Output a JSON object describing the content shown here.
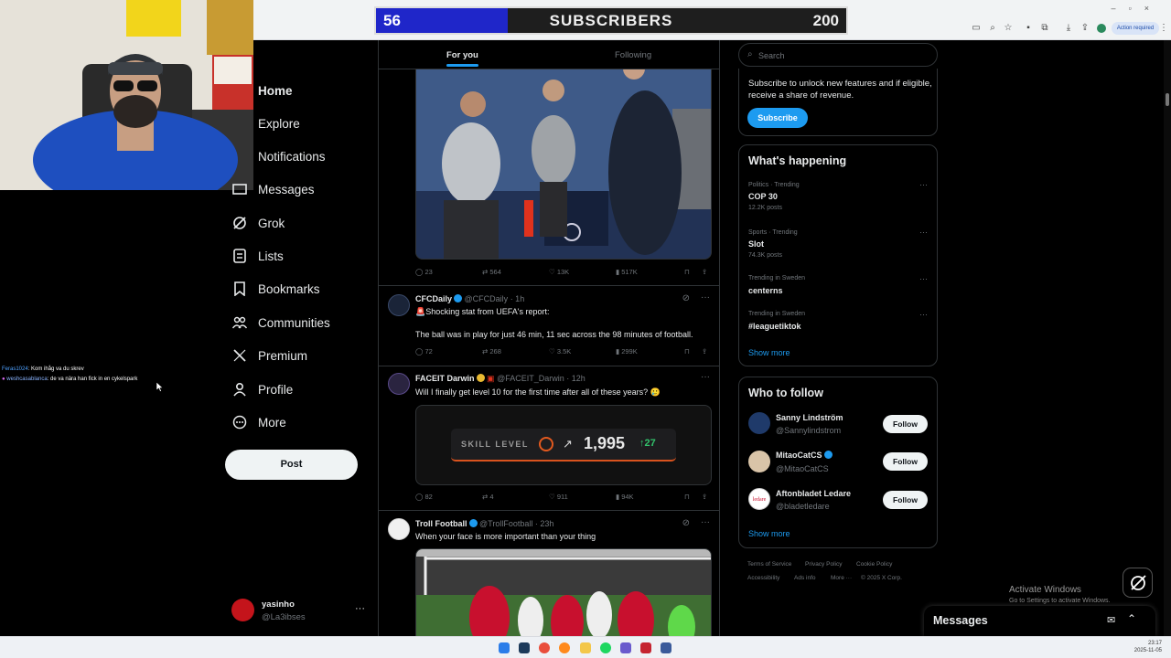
{
  "subscriber_goal": {
    "current": "56",
    "label": "SUBSCRIBERS",
    "goal": "200",
    "progress": 0.28
  },
  "browser": {
    "action_required": "Action required"
  },
  "chat": [
    {
      "user": "Feras1024",
      "message": ": Kom ihåg va du skrev"
    },
    {
      "user": "weshcasablanca",
      "message": ": de va nära han fick in en cykelspark"
    }
  ],
  "nav": {
    "items": [
      {
        "label": "Home",
        "icon": "home-icon"
      },
      {
        "label": "Explore",
        "icon": "search-icon"
      },
      {
        "label": "Notifications",
        "icon": "bell-icon"
      },
      {
        "label": "Messages",
        "icon": "mail-icon"
      },
      {
        "label": "Grok",
        "icon": "grok-icon"
      },
      {
        "label": "Lists",
        "icon": "list-icon"
      },
      {
        "label": "Bookmarks",
        "icon": "bookmark-icon"
      },
      {
        "label": "Communities",
        "icon": "people-icon"
      },
      {
        "label": "Premium",
        "icon": "x-logo-icon"
      },
      {
        "label": "Profile",
        "icon": "person-icon"
      },
      {
        "label": "More",
        "icon": "more-circle-icon"
      }
    ],
    "post_label": "Post",
    "account": {
      "name": "yasinho",
      "handle": "@La3ibses"
    }
  },
  "feed": {
    "tabs": {
      "for_you": "For you",
      "following": "Following"
    },
    "tweets": [
      {
        "stats": {
          "replies": "23",
          "reposts": "564",
          "likes": "13K",
          "views": "517K"
        }
      },
      {
        "name": "CFCDaily",
        "handle": "@CFCDaily",
        "time": "· 1h",
        "line1": "🚨Shocking stat from UEFA's report:",
        "line2": "The ball was in play for just 46 min, 11 sec across the 98 minutes of football.",
        "stats": {
          "replies": "72",
          "reposts": "268",
          "likes": "3.5K",
          "views": "299K"
        }
      },
      {
        "name": "FACEIT Darwin",
        "handle": "@FACEIT_Darwin",
        "time": "· 12h",
        "line1": "Will I finally get level 10 for the first time after all of these years? 🥲",
        "skill_label": "SKILL LEVEL",
        "skill_value": "1,995",
        "skill_delta": "27",
        "stats": {
          "replies": "82",
          "reposts": "4",
          "likes": "911",
          "views": "94K"
        }
      },
      {
        "name": "Troll Football",
        "handle": "@TrollFootball",
        "time": "· 23h",
        "line1": "When your face is more important than your thing"
      }
    ]
  },
  "right": {
    "search_placeholder": "Search",
    "premium": {
      "line1": "Subscribe to unlock new features and if eligible,",
      "line2": "receive a share of revenue.",
      "button": "Subscribe"
    },
    "happening": {
      "title": "What's happening",
      "trends": [
        {
          "category": "Politics · Trending",
          "name": "COP 30",
          "posts": "12.2K posts"
        },
        {
          "category": "Sports · Trending",
          "name": "Slot",
          "posts": "74.3K posts"
        },
        {
          "category": "Trending in Sweden",
          "name": "centerns",
          "posts": ""
        },
        {
          "category": "Trending in Sweden",
          "name": "#leaguetiktok",
          "posts": ""
        }
      ],
      "show_more": "Show more"
    },
    "who_to_follow": {
      "title": "Who to follow",
      "accounts": [
        {
          "name": "Sanny Lindström",
          "handle": "@Sannylindstrom"
        },
        {
          "name": "MitaoCatCS",
          "handle": "@MitaoCatCS"
        },
        {
          "name": "Aftonbladet Ledare",
          "handle": "@bladetledare"
        }
      ],
      "follow_label": "Follow",
      "show_more": "Show more"
    },
    "footer": {
      "terms": "Terms of Service",
      "privacy": "Privacy Policy",
      "cookie": "Cookie Policy",
      "accessibility": "Accessibility",
      "ads": "Ads info",
      "more": "More ···",
      "copyright": "© 2025 X Corp."
    }
  },
  "windows": {
    "activate_title": "Activate Windows",
    "activate_sub": "Go to Settings to activate Windows.",
    "time": "23:17",
    "date": "2025-11-05"
  },
  "messages_dock": {
    "label": "Messages"
  }
}
